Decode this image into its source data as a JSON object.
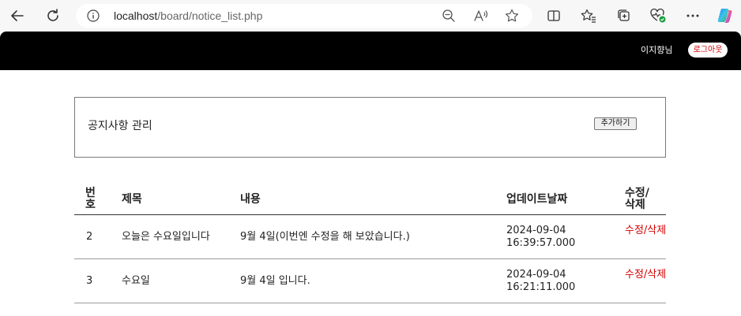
{
  "browser": {
    "url_host": "localhost",
    "url_path": "/board/notice_list.php"
  },
  "header": {
    "user_name": "이지향님",
    "logout_label": "로그아웃"
  },
  "admin": {
    "title": "공지사항 관리",
    "add_label": "추가하기"
  },
  "table": {
    "columns": {
      "number": "번호",
      "title": "제목",
      "content": "내용",
      "updated": "업데이트날짜",
      "edit_delete": "수정/삭제"
    },
    "rows": [
      {
        "number": "2",
        "title": "오늘은 수요일입니다",
        "content": "9월 4일(이번엔 수정을 해 보았습니다.)",
        "date": "2024-09-04",
        "time": "16:39:57.000",
        "edit_label": "수정/삭제"
      },
      {
        "number": "3",
        "title": "수요일",
        "content": "9월 4일 입니다.",
        "date": "2024-09-04",
        "time": "16:21:11.000",
        "edit_label": "수정/삭제"
      }
    ]
  },
  "colors": {
    "header_bg": "#000000",
    "accent_red": "#d40000"
  },
  "icons": [
    "back-icon",
    "refresh-icon",
    "info-icon",
    "zoom-out-icon",
    "read-aloud-icon",
    "favorite-star-icon",
    "split-screen-icon",
    "favorites-icon",
    "collections-icon",
    "browser-essentials-icon",
    "more-icon",
    "copilot-icon"
  ]
}
